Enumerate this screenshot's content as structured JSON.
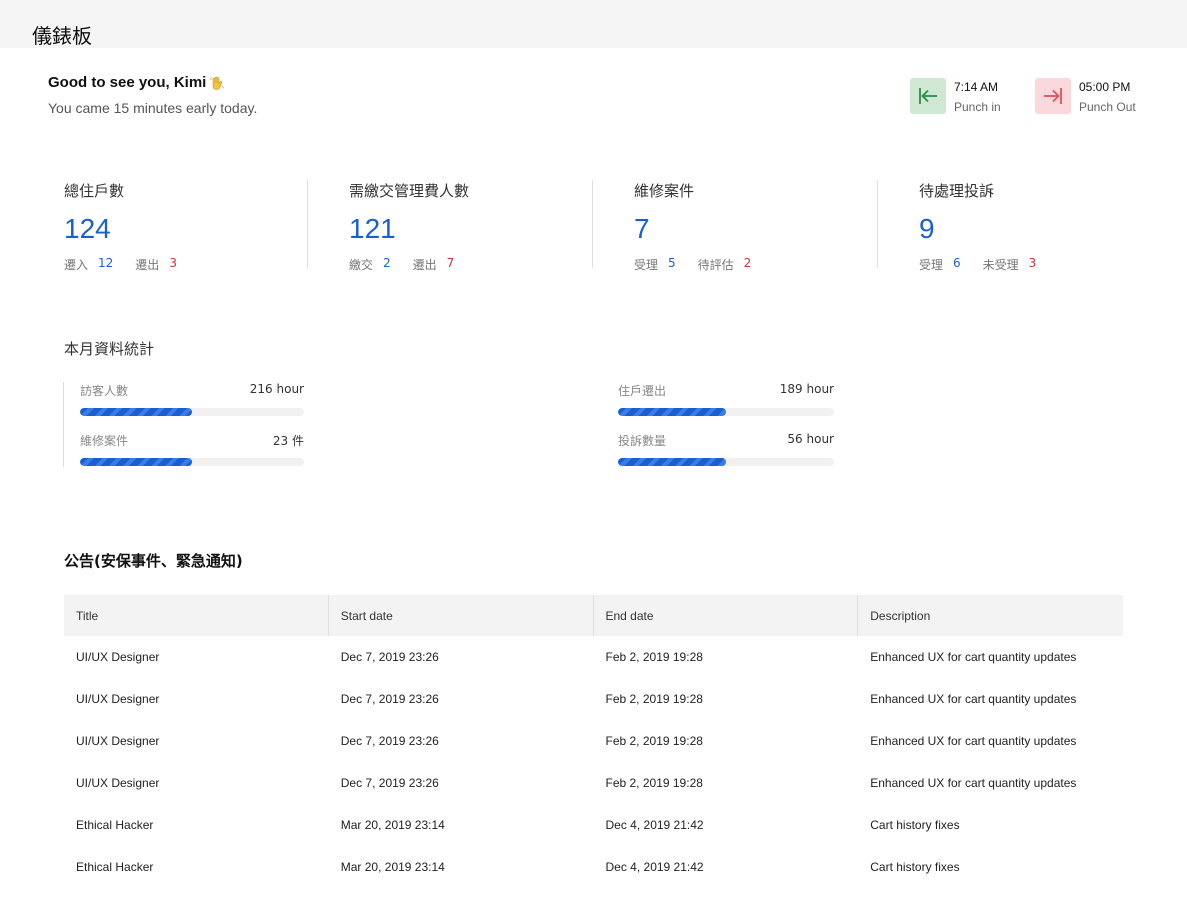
{
  "header": {
    "title": "儀錶板"
  },
  "greeting": {
    "hello": "Good to see you, Kimi",
    "subtitle": "You came 15 minutes early today."
  },
  "punch": {
    "in": {
      "time": "7:14 AM",
      "label": "Punch in",
      "color": "#2e8b45"
    },
    "out": {
      "time": "05:00 PM",
      "label": "Punch Out",
      "color": "#e0505c"
    }
  },
  "stats": [
    {
      "label": "總住戶數",
      "value": "124",
      "k1": "遷入",
      "v1": "12",
      "k2": "遷出",
      "v2": "3"
    },
    {
      "label": "需繳交管理費人數",
      "value": "121",
      "k1": "繳交",
      "v1": "2",
      "k2": "遷出",
      "v2": "7"
    },
    {
      "label": "維修案件",
      "value": "7",
      "k1": "受理",
      "v1": "5",
      "k2": "待評估",
      "v2": "2"
    },
    {
      "label": "待處理投訴",
      "value": "9",
      "k1": "受理",
      "v1": "6",
      "k2": "未受理",
      "v2": "3"
    }
  ],
  "monthly": {
    "title": "本月資料統計",
    "left": [
      {
        "label": "訪客人數",
        "value": "216 hour",
        "fraction": 0.5
      },
      {
        "label": "維修案件",
        "value": "23 件",
        "fraction": 0.5
      }
    ],
    "right": [
      {
        "label": "住戶遷出",
        "value": "189 hour",
        "fraction": 0.5
      },
      {
        "label": "投訴數量",
        "value": "56 hour",
        "fraction": 0.5
      }
    ]
  },
  "notices": {
    "title": "公告(安保事件、緊急通知)",
    "columns": [
      "Title",
      "Start date",
      "End date",
      "Description"
    ],
    "rows": [
      [
        "UI/UX Designer",
        "Dec 7, 2019 23:26",
        "Feb 2, 2019 19:28",
        "Enhanced UX for cart quantity updates"
      ],
      [
        "UI/UX Designer",
        "Dec 7, 2019 23:26",
        "Feb 2, 2019 19:28",
        "Enhanced UX for cart quantity updates"
      ],
      [
        "UI/UX Designer",
        "Dec 7, 2019 23:26",
        "Feb 2, 2019 19:28",
        "Enhanced UX for cart quantity updates"
      ],
      [
        "UI/UX Designer",
        "Dec 7, 2019 23:26",
        "Feb 2, 2019 19:28",
        "Enhanced UX for cart quantity updates"
      ],
      [
        "Ethical Hacker",
        "Mar 20, 2019 23:14",
        "Dec 4, 2019 21:42",
        "Cart history fixes"
      ],
      [
        "Ethical Hacker",
        "Mar 20, 2019 23:14",
        "Dec 4, 2019 21:42",
        "Cart history fixes"
      ]
    ]
  }
}
